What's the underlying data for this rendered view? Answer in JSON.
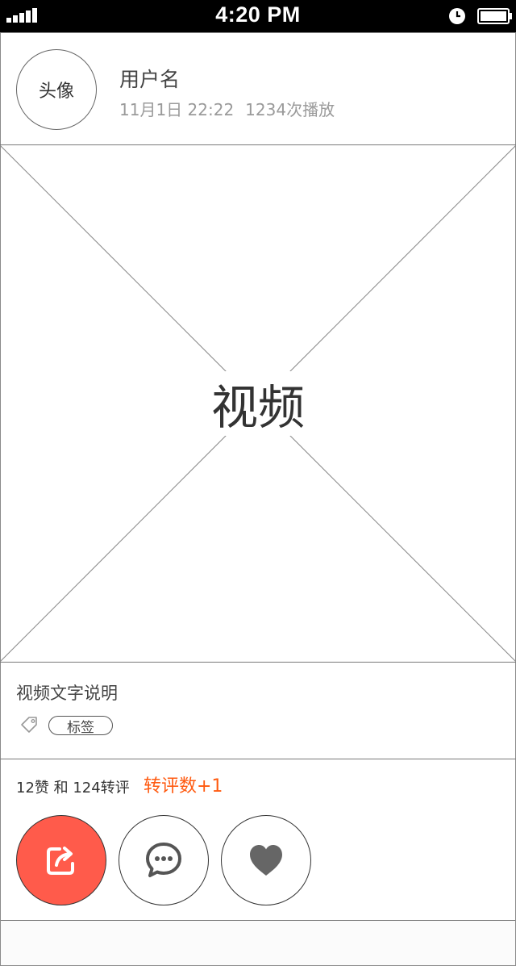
{
  "status_bar": {
    "time": "4:20 PM",
    "icons": [
      "signal-icon",
      "alarm-icon",
      "battery-icon"
    ]
  },
  "post": {
    "avatar_label": "头像",
    "username": "用户名",
    "date": "11月1日 22:22",
    "plays": "1234次播放"
  },
  "video": {
    "label": "视频"
  },
  "caption": {
    "text": "视频文字说明",
    "tag": "标签",
    "tag_icon": "tag-icon"
  },
  "stats": {
    "summary": "12赞 和 124转评",
    "highlight": "转评数+1"
  },
  "actions": [
    {
      "name": "share",
      "icon": "share-icon"
    },
    {
      "name": "comment",
      "icon": "comment-icon"
    },
    {
      "name": "like",
      "icon": "heart-icon"
    }
  ],
  "colors": {
    "accent": "#ff5a10",
    "share_button": "#ff5b4b",
    "muted_text": "#9a9a9a"
  }
}
